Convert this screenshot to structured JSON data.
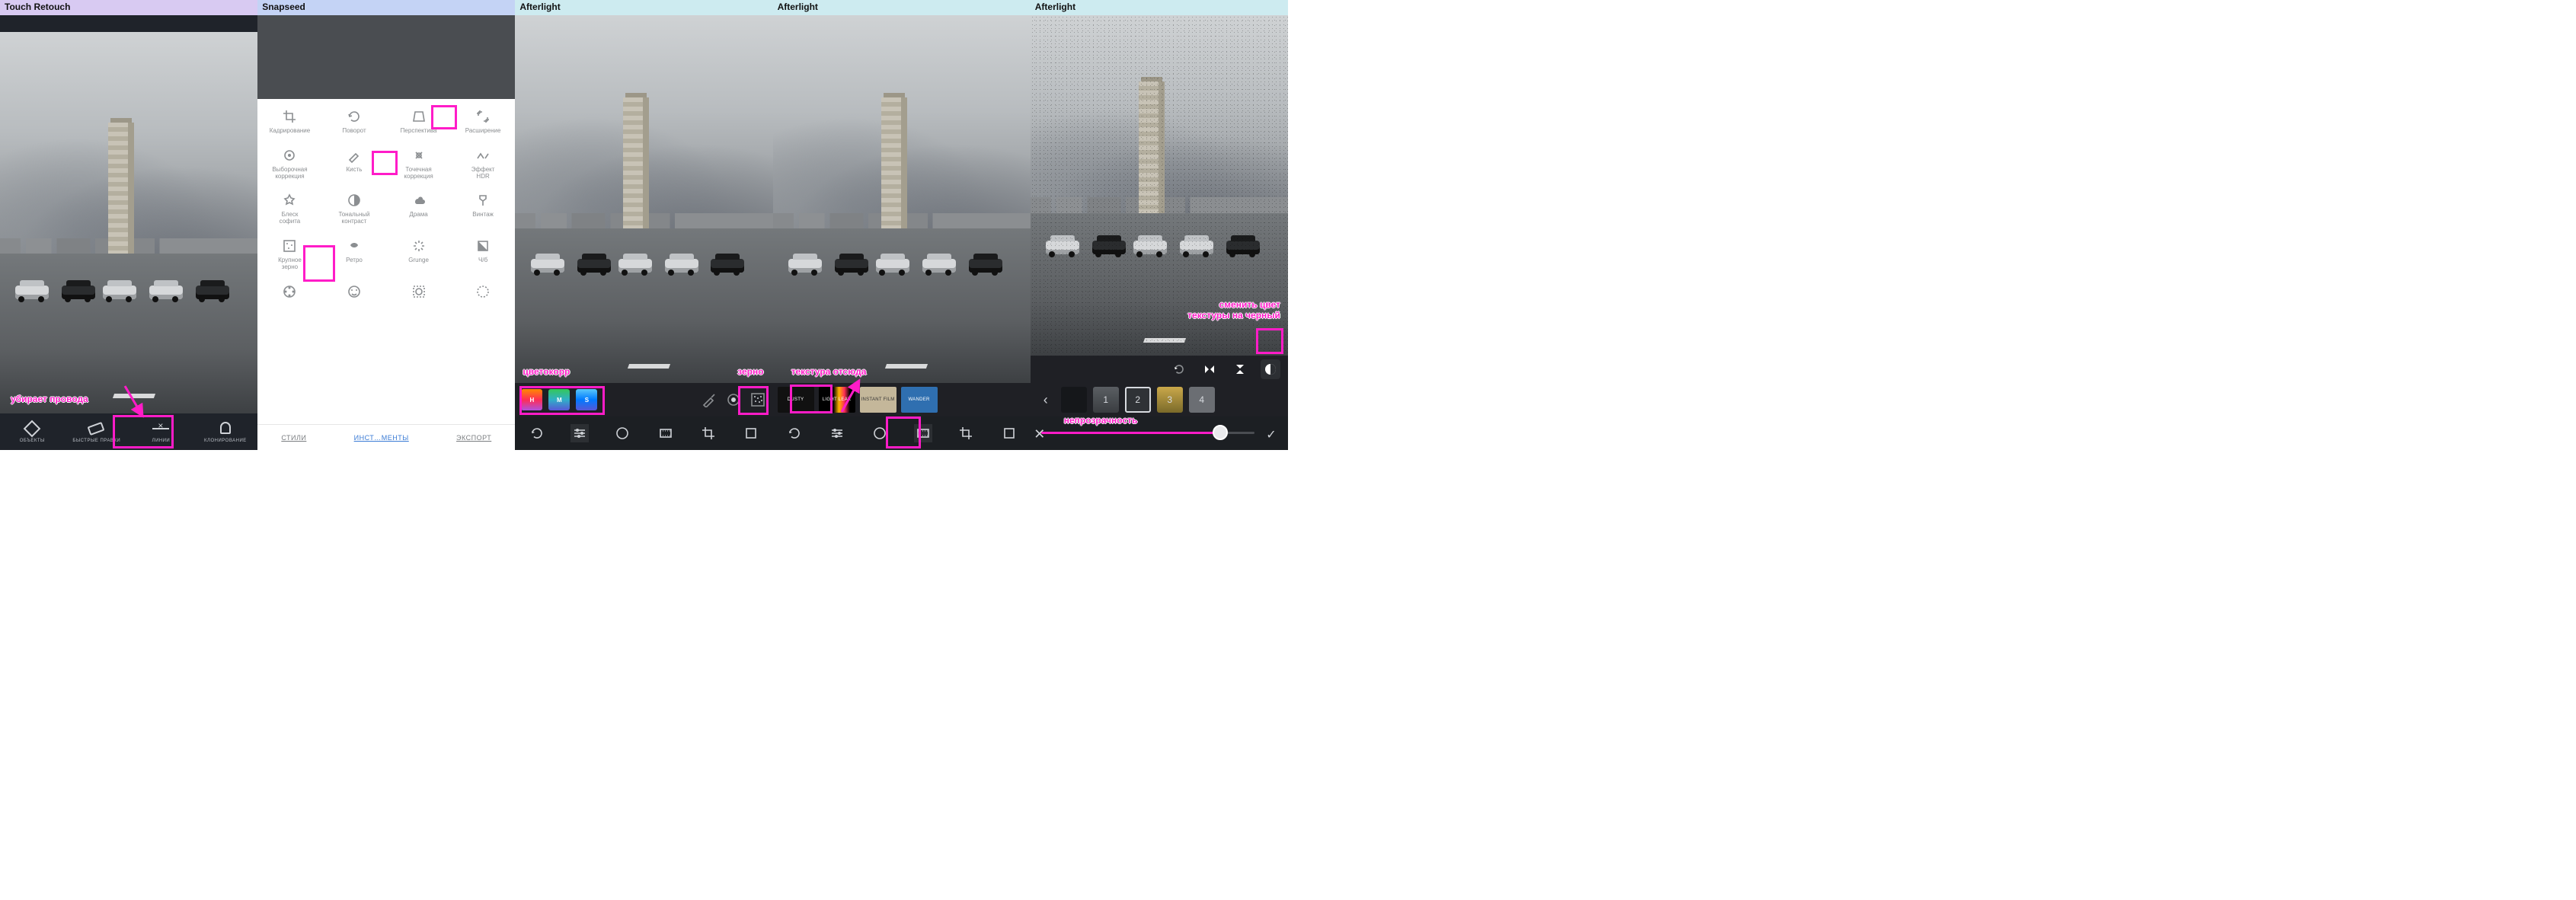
{
  "panels": [
    {
      "title": "Touch Retouch",
      "headerClass": "h-purple"
    },
    {
      "title": "Snapseed",
      "headerClass": "h-blue"
    },
    {
      "title": "Afterlight",
      "headerClass": "h-cyan"
    },
    {
      "title": "Afterlight",
      "headerClass": "h-cyan"
    },
    {
      "title": "Afterlight",
      "headerClass": "h-cyan"
    }
  ],
  "annotations": {
    "p1_wires": "убирает провода",
    "p3_cc": "цветокорр",
    "p3_grain": "зерно",
    "p4_tex": "текстура отсюда",
    "p5_swap": "сменить цвет\nтекстуры на черный",
    "p5_opacity": "непрозрачность"
  },
  "touchretouch": {
    "items": [
      {
        "label": "ОБЪЕКТЫ",
        "icon": "objects"
      },
      {
        "label": "БЫСТРЫЕ ПРАВКИ",
        "icon": "quick"
      },
      {
        "label": "ЛИНИИ",
        "icon": "lines"
      },
      {
        "label": "КЛОНИРОВАНИЕ",
        "icon": "clone"
      }
    ]
  },
  "snapseed": {
    "tabs": {
      "styles": "СТИЛИ",
      "tools": "ИНСТ…МЕНТЫ",
      "export": "ЭКСПОРТ"
    },
    "tools": [
      {
        "l": "Кадрирование",
        "i": "crop"
      },
      {
        "l": "Поворот",
        "i": "rotate"
      },
      {
        "l": "Перспектива",
        "i": "perspective"
      },
      {
        "l": "Расширение",
        "i": "expand"
      },
      {
        "l": "Выборочная коррекция",
        "i": "selective"
      },
      {
        "l": "Кисть",
        "i": "brush"
      },
      {
        "l": "Точечная коррекция",
        "i": "heal"
      },
      {
        "l": "Эффект HDR",
        "i": "hdr"
      },
      {
        "l": "Блеск софита",
        "i": "glamour"
      },
      {
        "l": "Тональный контраст",
        "i": "tonal"
      },
      {
        "l": "Драма",
        "i": "drama"
      },
      {
        "l": "Винтаж",
        "i": "vintage"
      },
      {
        "l": "Крупное зерно",
        "i": "grain"
      },
      {
        "l": "Ретро",
        "i": "retro"
      },
      {
        "l": "Grunge",
        "i": "grunge"
      },
      {
        "l": "Ч/б",
        "i": "bw"
      },
      {
        "l": "",
        "i": "reel"
      },
      {
        "l": "",
        "i": "face"
      },
      {
        "l": "",
        "i": "facecrop"
      },
      {
        "l": "",
        "i": "dots"
      }
    ]
  },
  "afterlight3": {
    "swatches": [
      "H",
      "M",
      "S"
    ],
    "bottom": [
      "revert",
      "sliders",
      "hue",
      "film",
      "crop",
      "square"
    ]
  },
  "afterlight4": {
    "thumbs": [
      {
        "l": "DUSTY",
        "c": "th-dusty"
      },
      {
        "l": "LIGHT LEAK",
        "c": "th-leak"
      },
      {
        "l": "INSTANT FILM",
        "c": "th-film"
      },
      {
        "l": "WANDER",
        "c": "th-wander"
      }
    ],
    "bottom": [
      "revert",
      "sliders",
      "hue",
      "film",
      "crop",
      "square"
    ]
  },
  "afterlight5": {
    "opts": [
      "rotate",
      "fliph",
      "flipv",
      "invert"
    ],
    "nums": [
      "1",
      "2",
      "3",
      "4"
    ],
    "slider": {
      "value": 84
    }
  },
  "colors": {
    "anno": "#ff1cc8"
  }
}
